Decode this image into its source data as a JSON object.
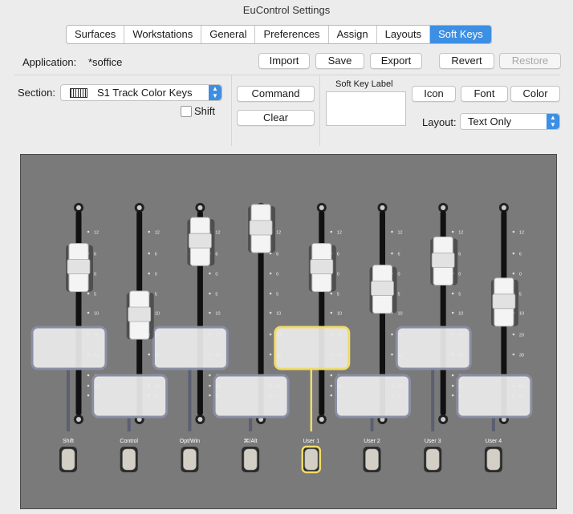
{
  "window": {
    "title": "EuControl Settings"
  },
  "tabs": [
    {
      "label": "Surfaces",
      "active": false
    },
    {
      "label": "Workstations",
      "active": false
    },
    {
      "label": "General",
      "active": false
    },
    {
      "label": "Preferences",
      "active": false
    },
    {
      "label": "Assign",
      "active": false
    },
    {
      "label": "Layouts",
      "active": false
    },
    {
      "label": "Soft Keys",
      "active": true
    }
  ],
  "application": {
    "label": "Application:",
    "value": "*soffice"
  },
  "toolbar": {
    "import": "Import",
    "save": "Save",
    "export": "Export",
    "revert": "Revert",
    "restore": "Restore"
  },
  "section": {
    "label": "Section:",
    "value": "S1 Track Color Keys",
    "shift_label": "Shift",
    "shift_checked": false
  },
  "commands": {
    "command": "Command",
    "clear": "Clear"
  },
  "soft_key": {
    "label_title": "Soft Key Label",
    "label_value": "",
    "icon": "Icon",
    "font": "Font",
    "color": "Color"
  },
  "layout": {
    "label": "Layout:",
    "value": "Text Only"
  },
  "scale_marks": [
    "12",
    "6",
    "0",
    "5",
    "10",
    "20",
    "30",
    "40",
    "60",
    "∞"
  ],
  "strips": [
    {
      "label": "Shift",
      "fader_level": 0.72,
      "selected": false
    },
    {
      "label": "Control",
      "fader_level": 0.5,
      "selected": false
    },
    {
      "label": "Opt/Win",
      "fader_level": 0.84,
      "selected": false
    },
    {
      "label": "⌘/Alt",
      "fader_level": 0.9,
      "selected": false
    },
    {
      "label": "User 1",
      "fader_level": 0.72,
      "selected": true
    },
    {
      "label": "User 2",
      "fader_level": 0.62,
      "selected": false
    },
    {
      "label": "User 3",
      "fader_level": 0.75,
      "selected": false
    },
    {
      "label": "User 4",
      "fader_level": 0.56,
      "selected": false
    }
  ],
  "colors": {
    "accent": "#3d8fe3",
    "selected_outline": "#f0dc6a",
    "panel": "#7a7a7a",
    "label_box": "#ececec"
  }
}
